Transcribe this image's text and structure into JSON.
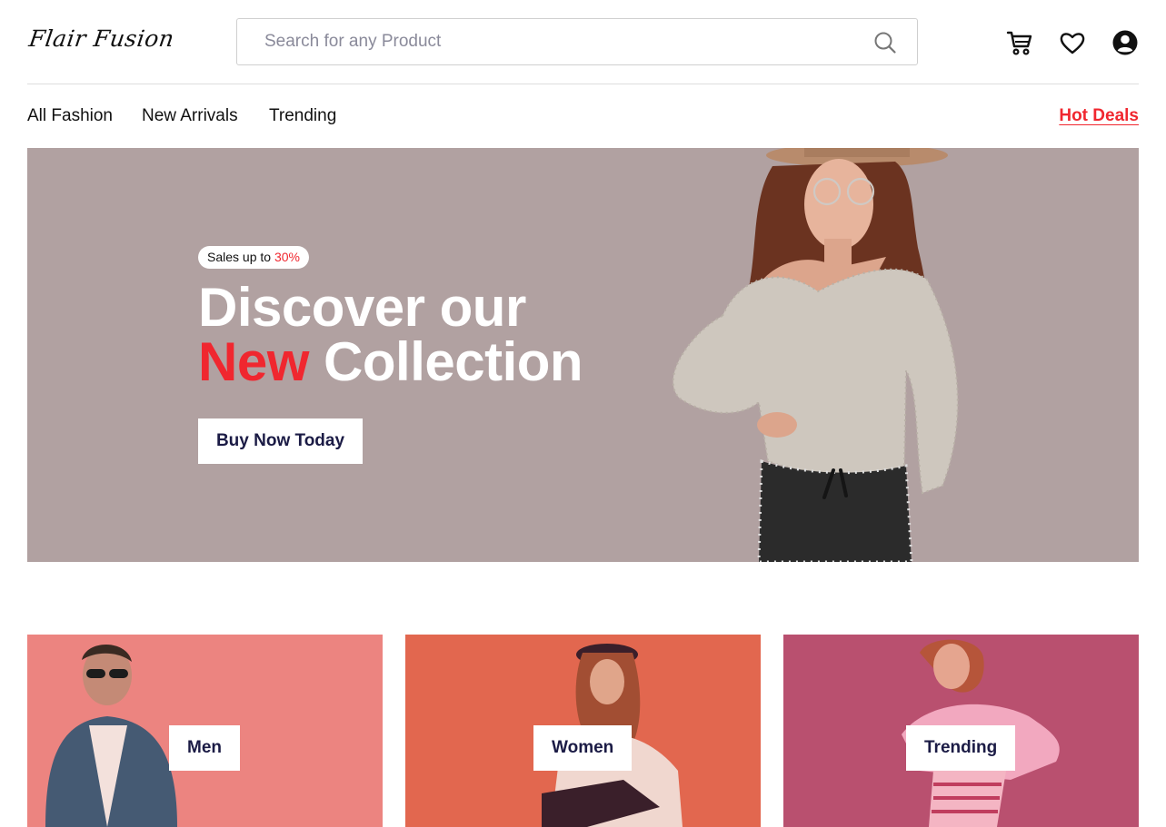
{
  "header": {
    "logo": "Flair Fusion",
    "search": {
      "placeholder": "Search for any Product",
      "icon": "search-icon"
    },
    "icons": [
      "cart-icon",
      "heart-icon",
      "user-account-icon"
    ]
  },
  "nav": {
    "items": [
      {
        "label": "All Fashion"
      },
      {
        "label": "New Arrivals"
      },
      {
        "label": "Trending"
      }
    ],
    "hot_deals": "Hot Deals"
  },
  "hero": {
    "badge_prefix": "Sales up to",
    "badge_value": "30%",
    "title_line1": "Discover our",
    "title_highlight": "New",
    "title_rest": "Collection",
    "button": "Buy Now Today",
    "background": "#b1a1a1"
  },
  "categories": [
    {
      "label": "Men",
      "color": "#ec8480"
    },
    {
      "label": "Women",
      "color": "#e2674f"
    },
    {
      "label": "Trending",
      "color": "#b9506f"
    }
  ],
  "colors": {
    "accent": "#f0272f",
    "button_text": "#1b1b45",
    "hero_bg": "#b1a1a1"
  }
}
